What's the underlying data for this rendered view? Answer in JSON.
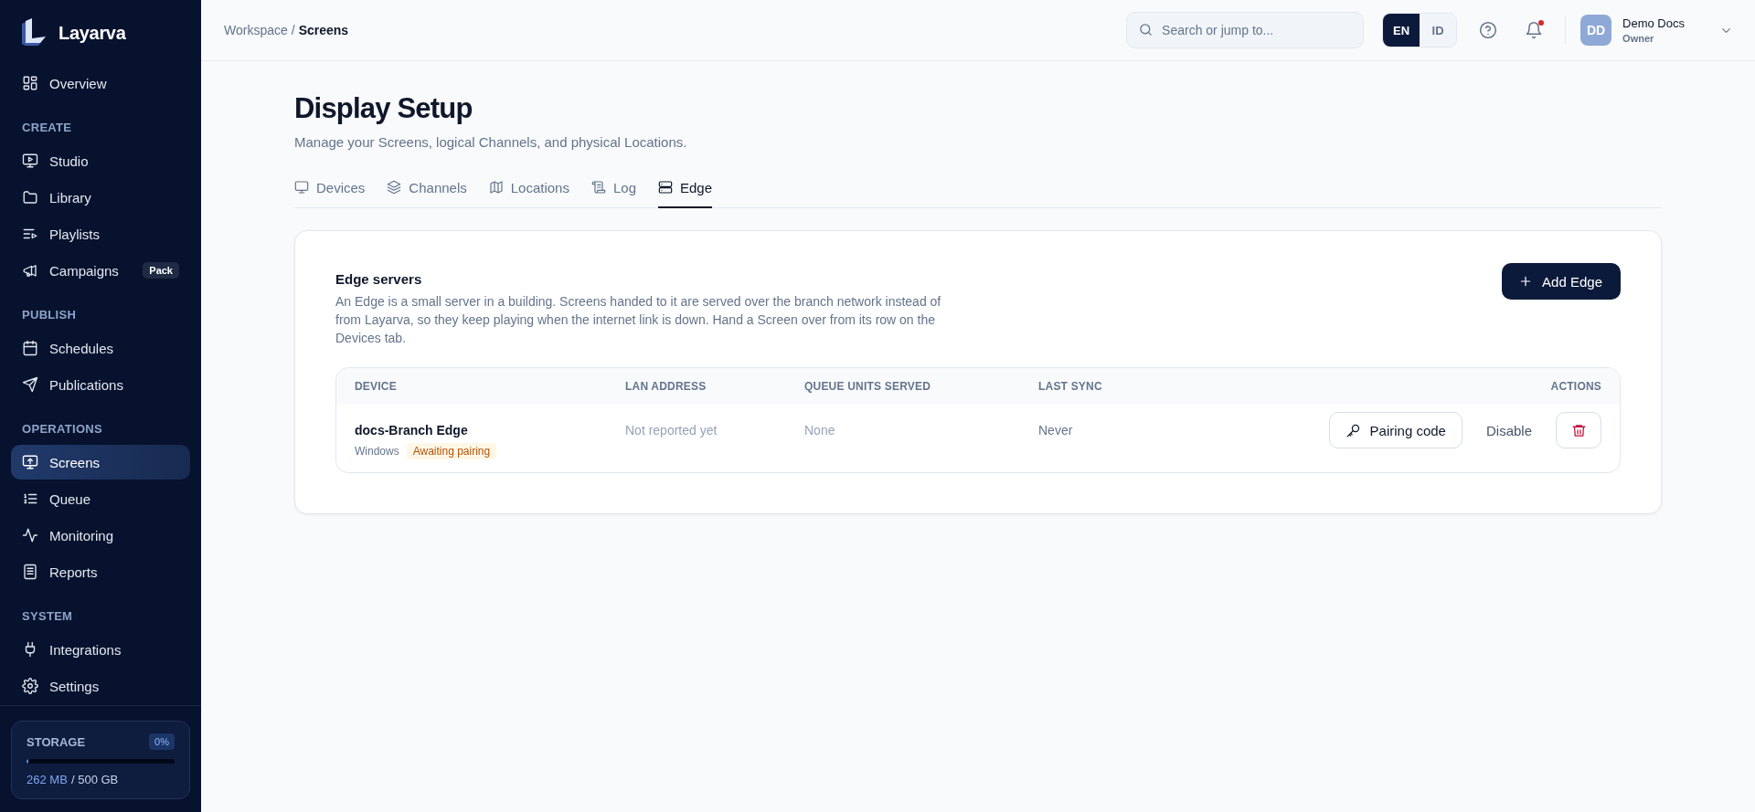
{
  "sidebar": {
    "brand": "Layarva",
    "groups": [
      {
        "items": [
          {
            "label": "Overview",
            "selected": false
          }
        ]
      },
      {
        "heading": "CREATE",
        "items": [
          {
            "label": "Studio",
            "selected": false
          },
          {
            "label": "Library",
            "selected": false
          },
          {
            "label": "Playlists",
            "selected": false
          },
          {
            "label": "Campaigns",
            "selected": false,
            "badge": "Pack"
          }
        ]
      },
      {
        "heading": "PUBLISH",
        "items": [
          {
            "label": "Schedules",
            "selected": false
          },
          {
            "label": "Publications",
            "selected": false
          }
        ]
      },
      {
        "heading": "OPERATIONS",
        "items": [
          {
            "label": "Screens",
            "selected": true
          },
          {
            "label": "Queue",
            "selected": false
          },
          {
            "label": "Monitoring",
            "selected": false
          },
          {
            "label": "Reports",
            "selected": false
          }
        ]
      },
      {
        "heading": "SYSTEM",
        "items": [
          {
            "label": "Integrations",
            "selected": false
          },
          {
            "label": "Settings",
            "selected": false
          }
        ]
      }
    ],
    "storage": {
      "label": "STORAGE",
      "percent": "0%",
      "level": 0.01,
      "used": "262 MB",
      "separator": "/",
      "capacity": "500 GB"
    }
  },
  "header": {
    "breadcrumb": [
      "Workspace",
      "Screens"
    ],
    "breadcrumb_separator": "/",
    "search": {
      "placeholder": "Search or jump to..."
    },
    "languages": [
      {
        "label": "EN",
        "selected": true
      },
      {
        "label": "ID",
        "selected": false
      }
    ],
    "notifications": {
      "unread": true
    },
    "user": {
      "initials": "DD",
      "name": "Demo Docs",
      "role": "Owner"
    }
  },
  "page": {
    "title": "Display Setup",
    "subtitle": "Manage your Screens, logical Channels, and physical Locations.",
    "tabs": [
      {
        "label": "Devices",
        "selected": false
      },
      {
        "label": "Channels",
        "selected": false
      },
      {
        "label": "Locations",
        "selected": false
      },
      {
        "label": "Log",
        "selected": false
      },
      {
        "label": "Edge",
        "selected": true
      }
    ],
    "card": {
      "title": "Edge servers",
      "description": "An Edge is a small server in a building. Screens handed to it are served over the branch network instead of from Layarva, so they keep playing when the internet link is down. Hand a Screen over from its row on the Devices tab.",
      "add_button": "Add Edge",
      "table": {
        "columns": [
          "DEVICE",
          "LAN ADDRESS",
          "QUEUE UNITS SERVED",
          "LAST SYNC",
          "ACTIONS"
        ],
        "rows": [
          {
            "device": "docs-Branch Edge",
            "platform": "Windows",
            "status": "Awaiting pairing",
            "lan_address": "Not reported yet",
            "queue_units_served": "None",
            "last_sync": "Never",
            "pairing_button": "Pairing code",
            "disable_button": "Disable"
          }
        ]
      }
    }
  }
}
